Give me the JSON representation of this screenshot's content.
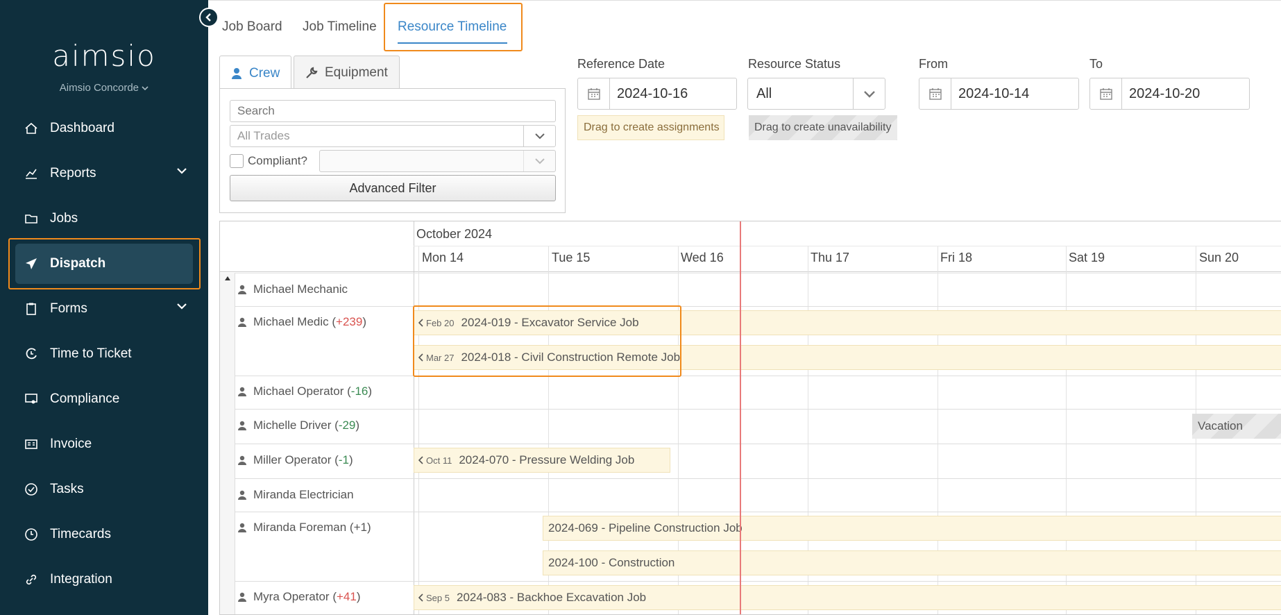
{
  "sidebar": {
    "logo": "aimsio",
    "org": "Aimsio Concorde",
    "items": [
      {
        "label": "Dashboard",
        "icon": "home-icon"
      },
      {
        "label": "Reports",
        "icon": "chart-icon",
        "expandable": true
      },
      {
        "label": "Jobs",
        "icon": "folder-icon"
      },
      {
        "label": "Dispatch",
        "icon": "send-icon",
        "active": true
      },
      {
        "label": "Forms",
        "icon": "clipboard-icon",
        "expandable": true
      },
      {
        "label": "Time to Ticket",
        "icon": "clock-arrow-icon"
      },
      {
        "label": "Compliance",
        "icon": "certificate-icon"
      },
      {
        "label": "Invoice",
        "icon": "invoice-icon"
      },
      {
        "label": "Tasks",
        "icon": "check-circle-icon"
      },
      {
        "label": "Timecards",
        "icon": "clock-icon"
      },
      {
        "label": "Integration",
        "icon": "link-icon"
      }
    ]
  },
  "tabs": {
    "job_board": "Job Board",
    "job_timeline": "Job Timeline",
    "resource_timeline": "Resource Timeline"
  },
  "panel": {
    "crew": "Crew",
    "equipment": "Equipment",
    "search_placeholder": "Search",
    "trades": "All Trades",
    "compliant": "Compliant?",
    "advanced_filter": "Advanced Filter"
  },
  "fields": {
    "reference_date_label": "Reference Date",
    "reference_date": "2024-10-16",
    "resource_status_label": "Resource Status",
    "resource_status": "All",
    "from_label": "From",
    "from": "2024-10-14",
    "to_label": "To",
    "to": "2024-10-20",
    "hint_assign": "Drag to create assignments",
    "hint_unavail": "Drag to create unavailability"
  },
  "timeline": {
    "month": "October 2024",
    "days": [
      "Mon 14",
      "Tue 15",
      "Wed 16",
      "Thu 17",
      "Fri 18",
      "Sat 19",
      "Sun 20"
    ],
    "rows": [
      {
        "name": "Michael Mechanic",
        "delta": ""
      },
      {
        "name": "Michael Medic",
        "delta": "+239"
      },
      {
        "name": "Michael Operator",
        "delta": "-16"
      },
      {
        "name": "Michelle Driver",
        "delta": "-29"
      },
      {
        "name": "Miller Operator",
        "delta": "-1"
      },
      {
        "name": "Miranda Electrician",
        "delta": ""
      },
      {
        "name": "Miranda Foreman",
        "delta": "+1"
      },
      {
        "name": "Myra Operator",
        "delta": "+41"
      }
    ],
    "bars": {
      "b1": {
        "prev": "Feb 20",
        "label": "2024-019 - Excavator Service Job"
      },
      "b2": {
        "prev": "Mar 27",
        "label": "2024-018 - Civil Construction Remote Job"
      },
      "b3": {
        "label": "Vacation"
      },
      "b4": {
        "prev": "Oct 11",
        "label": "2024-070 - Pressure Welding Job"
      },
      "b5": {
        "label": "2024-069 - Pipeline Construction Job"
      },
      "b6": {
        "label": "2024-100 - Construction"
      },
      "b7": {
        "prev": "Sep 5",
        "label": "2024-083 - Backhoe Excavation Job"
      }
    }
  }
}
